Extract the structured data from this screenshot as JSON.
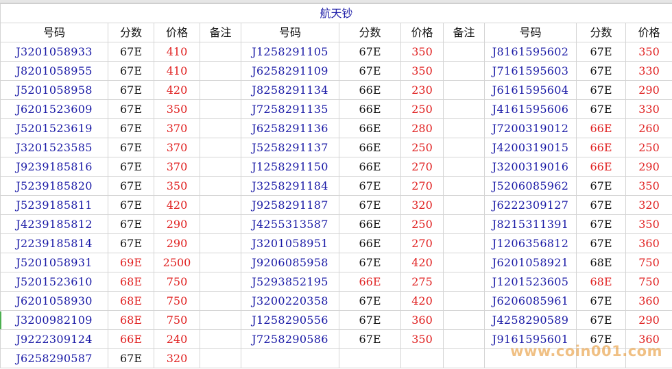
{
  "title": "航天钞",
  "headers": {
    "code": "号码",
    "score": "分数",
    "price": "价格",
    "note": "备注"
  },
  "group1": [
    {
      "code": "J3201058933",
      "score": "67E",
      "score_red": false,
      "price": "410"
    },
    {
      "code": "J8201058955",
      "score": "67E",
      "score_red": false,
      "price": "410"
    },
    {
      "code": "J5201058958",
      "score": "67E",
      "score_red": false,
      "price": "420"
    },
    {
      "code": "J6201523609",
      "score": "67E",
      "score_red": false,
      "price": "350"
    },
    {
      "code": "J5201523619",
      "score": "67E",
      "score_red": false,
      "price": "370"
    },
    {
      "code": "J3201523585",
      "score": "67E",
      "score_red": false,
      "price": "370"
    },
    {
      "code": "J9239185816",
      "score": "67E",
      "score_red": false,
      "price": "370"
    },
    {
      "code": "J5239185820",
      "score": "67E",
      "score_red": false,
      "price": "350"
    },
    {
      "code": "J5239185811",
      "score": "67E",
      "score_red": false,
      "price": "420"
    },
    {
      "code": "J4239185812",
      "score": "67E",
      "score_red": false,
      "price": "290"
    },
    {
      "code": "J2239185814",
      "score": "67E",
      "score_red": false,
      "price": "290"
    },
    {
      "code": "J5201058931",
      "score": "69E",
      "score_red": true,
      "price": "2500"
    },
    {
      "code": "J5201523610",
      "score": "68E",
      "score_red": true,
      "price": "750"
    },
    {
      "code": "J6201058930",
      "score": "68E",
      "score_red": true,
      "price": "750"
    },
    {
      "code": "J3200982109",
      "score": "68E",
      "score_red": true,
      "price": "750"
    },
    {
      "code": "J9222309124",
      "score": "66E",
      "score_red": true,
      "price": "240"
    },
    {
      "code": "J6258290587",
      "score": "67E",
      "score_red": false,
      "price": "320"
    }
  ],
  "group2": [
    {
      "code": "J1258291105",
      "score": "67E",
      "score_red": false,
      "price": "350"
    },
    {
      "code": "J6258291109",
      "score": "67E",
      "score_red": false,
      "price": "350"
    },
    {
      "code": "J8258291134",
      "score": "66E",
      "score_red": false,
      "price": "230"
    },
    {
      "code": "J7258291135",
      "score": "66E",
      "score_red": false,
      "price": "250"
    },
    {
      "code": "J6258291136",
      "score": "66E",
      "score_red": false,
      "price": "280"
    },
    {
      "code": "J5258291137",
      "score": "66E",
      "score_red": false,
      "price": "250"
    },
    {
      "code": "J1258291150",
      "score": "66E",
      "score_red": false,
      "price": "270"
    },
    {
      "code": "J3258291184",
      "score": "67E",
      "score_red": false,
      "price": "270"
    },
    {
      "code": "J9258291187",
      "score": "67E",
      "score_red": false,
      "price": "320"
    },
    {
      "code": "J4255313587",
      "score": "66E",
      "score_red": false,
      "price": "250"
    },
    {
      "code": "J3201058951",
      "score": "66E",
      "score_red": false,
      "price": "270"
    },
    {
      "code": "J9206085958",
      "score": "67E",
      "score_red": false,
      "price": "420"
    },
    {
      "code": "J5293852195",
      "score": "66E",
      "score_red": true,
      "price": "275"
    },
    {
      "code": "J3200220358",
      "score": "67E",
      "score_red": false,
      "price": "420"
    },
    {
      "code": "J1258290556",
      "score": "67E",
      "score_red": false,
      "price": "360"
    },
    {
      "code": "J7258290586",
      "score": "67E",
      "score_red": false,
      "price": "350"
    }
  ],
  "group3": [
    {
      "code": "J8161595602",
      "score": "67E",
      "score_red": false,
      "price": "350"
    },
    {
      "code": "J7161595603",
      "score": "67E",
      "score_red": false,
      "price": "330"
    },
    {
      "code": "J6161595604",
      "score": "67E",
      "score_red": false,
      "price": "290"
    },
    {
      "code": "J4161595606",
      "score": "67E",
      "score_red": false,
      "price": "330"
    },
    {
      "code": "J7200319012",
      "score": "66E",
      "score_red": true,
      "price": "260"
    },
    {
      "code": "J4200319015",
      "score": "66E",
      "score_red": true,
      "price": "250"
    },
    {
      "code": "J3200319016",
      "score": "66E",
      "score_red": true,
      "price": "290"
    },
    {
      "code": "J5206085962",
      "score": "67E",
      "score_red": false,
      "price": "350"
    },
    {
      "code": "J6222309127",
      "score": "67E",
      "score_red": false,
      "price": "320"
    },
    {
      "code": "J8215311391",
      "score": "67E",
      "score_red": false,
      "price": "350"
    },
    {
      "code": "J1206356812",
      "score": "67E",
      "score_red": false,
      "price": "360"
    },
    {
      "code": "J6201058921",
      "score": "68E",
      "score_red": false,
      "price": "750"
    },
    {
      "code": "J1201523605",
      "score": "68E",
      "score_red": true,
      "price": "750"
    },
    {
      "code": "J6206085961",
      "score": "67E",
      "score_red": false,
      "price": "360"
    },
    {
      "code": "J4258290589",
      "score": "67E",
      "score_red": false,
      "price": "290"
    },
    {
      "code": "J9161595601",
      "score": "67E",
      "score_red": false,
      "price": "360"
    }
  ],
  "watermark": "www.coin001.com",
  "colors": {
    "code_blue": "#1a1aa6",
    "price_red": "#e02020",
    "grid_line": "#d4d4d4"
  }
}
